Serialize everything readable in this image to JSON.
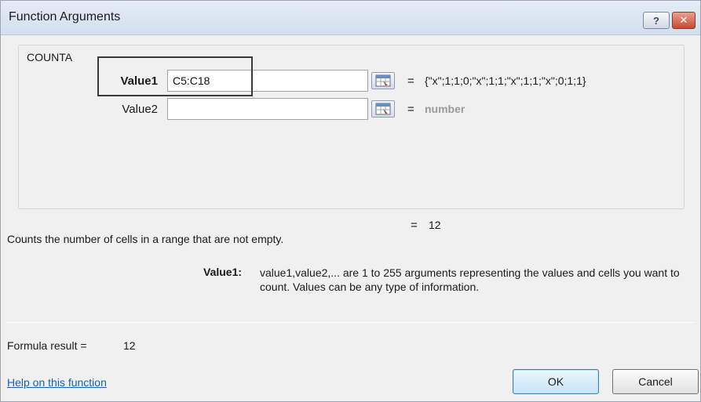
{
  "window": {
    "title": "Function Arguments",
    "help_glyph": "?",
    "close_glyph": "✕"
  },
  "function": {
    "name": "COUNTA",
    "args": [
      {
        "label": "Value1",
        "value": "C5:C18",
        "result": "{\"x\";1;1;0;\"x\";1;1;\"x\";1;1;\"x\";0;1;1}"
      },
      {
        "label": "Value2",
        "value": "",
        "result": "number"
      }
    ],
    "equals_sign": "=",
    "result": "12",
    "description": "Counts the number of cells in a range that are not empty.",
    "detail_label": "Value1:",
    "detail_text": "value1,value2,... are 1 to 255 arguments representing the values and cells you want to count. Values can be any type of information."
  },
  "footer": {
    "formula_result_label": "Formula result =",
    "formula_result_value": "12",
    "help_link": "Help on this function",
    "ok_label": "OK",
    "cancel_label": "Cancel"
  }
}
